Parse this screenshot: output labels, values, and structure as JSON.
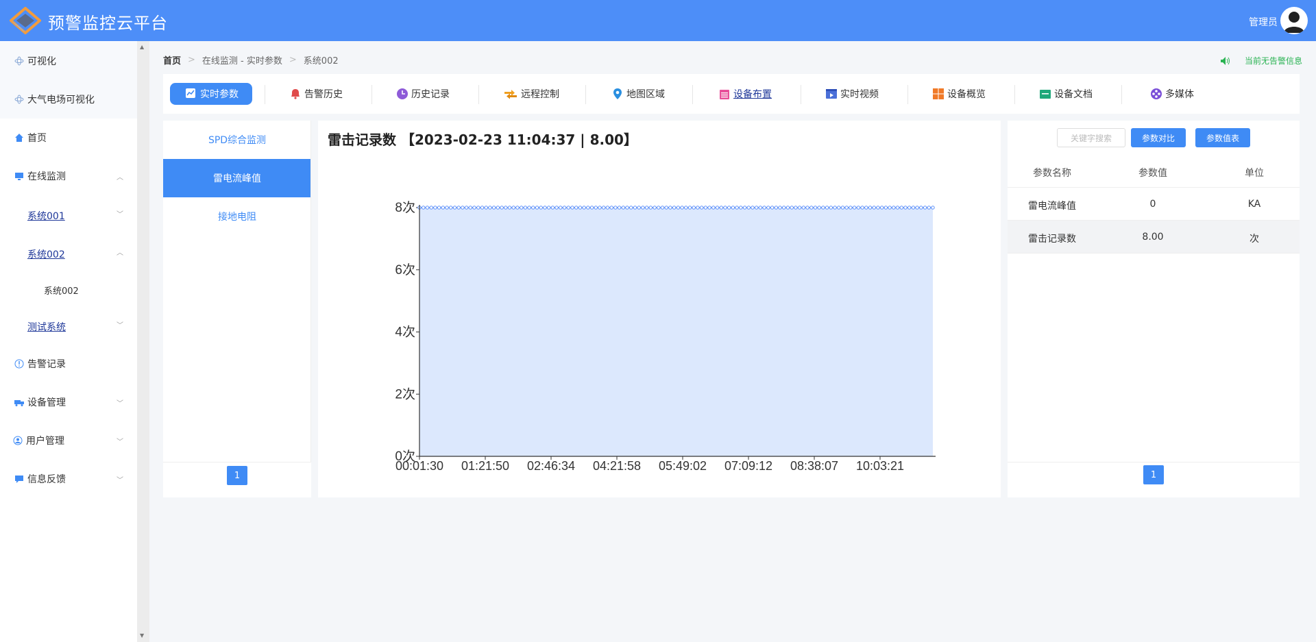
{
  "header": {
    "brand": "预警监控云平台",
    "user": "管理员",
    "colors": {
      "header_bg": "#4d8ef8",
      "accent": "#3f8bf5",
      "alarm_green": "#29b352"
    }
  },
  "sidebar": {
    "items": [
      {
        "label": "可视化",
        "icon": "atom-icon"
      },
      {
        "label": "大气电场可视化",
        "icon": "atom-icon"
      },
      {
        "label": "首页",
        "icon": "home-icon"
      },
      {
        "label": "在线监测",
        "icon": "monitor-icon"
      },
      {
        "label": "告警记录",
        "icon": "info-circle-icon"
      },
      {
        "label": "设备管理",
        "icon": "truck-icon"
      },
      {
        "label": "用户管理",
        "icon": "user-circle-icon"
      },
      {
        "label": "信息反馈",
        "icon": "chat-icon"
      }
    ],
    "subitems": [
      {
        "label": "系统001"
      },
      {
        "label": "系统002"
      },
      {
        "label": "测试系统"
      }
    ],
    "leaf": "系统002"
  },
  "breadcrumb": {
    "home": "首页",
    "middle": "在线监测 - 实时参数",
    "current": "系统002"
  },
  "alarm_text": "当前无告警信息",
  "tabs": [
    {
      "label": "实时参数",
      "icon": "trend-icon"
    },
    {
      "label": "告警历史",
      "icon": "bell-icon"
    },
    {
      "label": "历史记录",
      "icon": "clock-icon"
    },
    {
      "label": "远程控制",
      "icon": "swap-icon"
    },
    {
      "label": "地图区域",
      "icon": "location-pin-icon"
    },
    {
      "label": "设备布置",
      "icon": "calendar-icon"
    },
    {
      "label": "实时视频",
      "icon": "video-icon"
    },
    {
      "label": "设备概览",
      "icon": "grid-icon"
    },
    {
      "label": "设备文档",
      "icon": "folder-icon"
    },
    {
      "label": "多媒体",
      "icon": "media-icon"
    }
  ],
  "list_panel": {
    "items": [
      "SPD综合监测",
      "雷电流峰值",
      "接地电阻"
    ],
    "active_index": 1,
    "page": "1"
  },
  "chart_title": "雷击记录数 【2023-02-23 11:04:37 | 8.00】",
  "chart_data": {
    "type": "area",
    "title": "雷击记录数 【2023-02-23 11:04:37 | 8.00】",
    "y_unit": "次",
    "ylim": [
      0,
      8
    ],
    "y_ticks": [
      "0次",
      "2次",
      "4次",
      "6次",
      "8次"
    ],
    "x_ticks": [
      "00:01:30",
      "01:21:50",
      "02:46:34",
      "04:21:58",
      "05:49:02",
      "07:09:12",
      "08:38:07",
      "10:03:21"
    ],
    "series": [
      {
        "values": [
          8,
          8,
          8,
          8,
          8,
          8,
          8,
          8
        ]
      }
    ],
    "constant_value": 8,
    "point_count": 132,
    "grid": true,
    "colors": {
      "line": "#5b8ff9",
      "fill": "#dce8fd",
      "grid": "#e0e0e0"
    }
  },
  "param_panel": {
    "search_placeholder": "关键字搜索",
    "compare_button": "参数对比",
    "value_table_button": "参数值表",
    "columns": [
      "参数名称",
      "参数值",
      "单位"
    ],
    "rows": [
      [
        "雷电流峰值",
        "0",
        "KA"
      ],
      [
        "雷击记录数",
        "8.00",
        "次"
      ]
    ],
    "page": "1"
  }
}
